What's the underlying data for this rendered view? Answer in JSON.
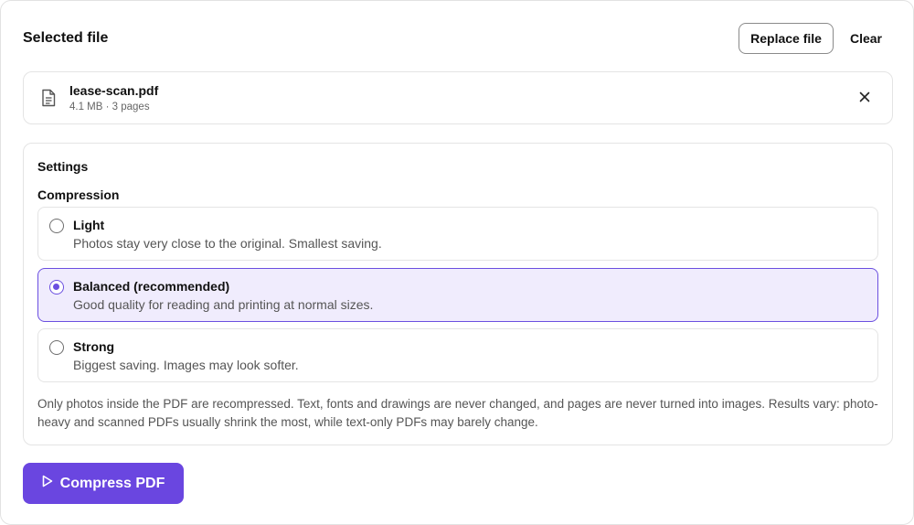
{
  "header": {
    "title": "Selected file",
    "replace_label": "Replace file",
    "clear_label": "Clear"
  },
  "file": {
    "name": "lease-scan.pdf",
    "meta": "4.1 MB · 3 pages",
    "icon": "document-icon",
    "remove_icon": "close-icon"
  },
  "settings": {
    "title": "Settings",
    "compression_label": "Compression",
    "selected": "balanced",
    "options": [
      {
        "id": "light",
        "title": "Light",
        "description": "Photos stay very close to the original. Smallest saving."
      },
      {
        "id": "balanced",
        "title": "Balanced (recommended)",
        "description": "Good quality for reading and printing at normal sizes."
      },
      {
        "id": "strong",
        "title": "Strong",
        "description": "Biggest saving. Images may look softer."
      }
    ],
    "note": "Only photos inside the PDF are recompressed. Text, fonts and drawings are never changed, and pages are never turned into images. Results vary: photo-heavy and scanned PDFs usually shrink the most, while text-only PDFs may barely change."
  },
  "action": {
    "compress_label": "Compress PDF",
    "icon": "play-icon"
  },
  "colors": {
    "accent": "#6a46e0",
    "selected_bg": "#f0ecfd"
  }
}
